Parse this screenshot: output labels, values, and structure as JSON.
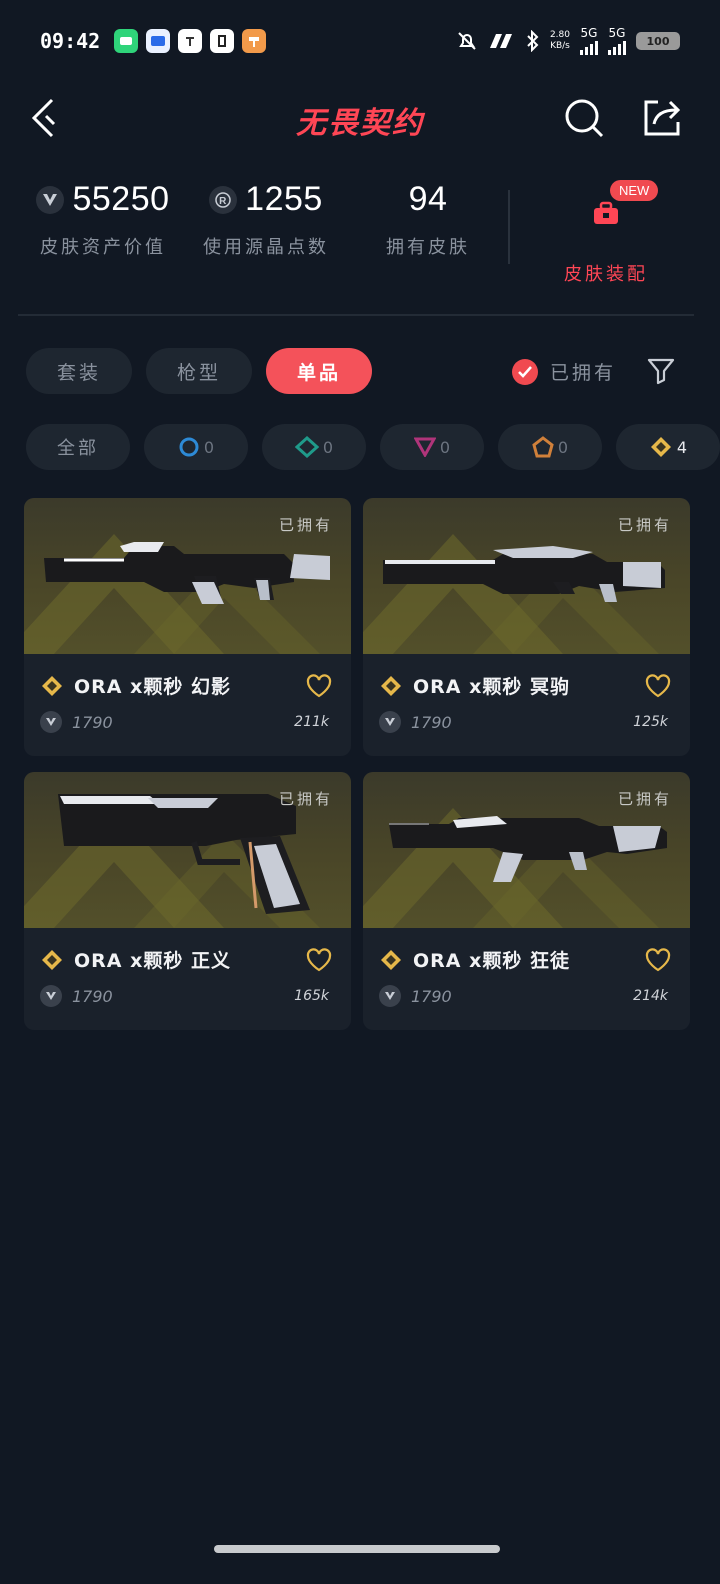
{
  "status_bar": {
    "time": "09:42",
    "net_speed_top": "2.80",
    "net_speed_bottom": "KB/s",
    "signal1": "5G",
    "signal2": "5G",
    "battery": "100"
  },
  "header": {
    "logo_text": "无畏契约"
  },
  "stats": {
    "asset_value": "55250",
    "asset_label": "皮肤资产价值",
    "radianite": "1255",
    "radianite_label": "使用源晶点数",
    "skins_count": "94",
    "skins_label": "拥有皮肤",
    "equip_label": "皮肤装配",
    "new_badge": "NEW"
  },
  "category_tabs": [
    {
      "label": "套装",
      "active": false
    },
    {
      "label": "枪型",
      "active": false
    },
    {
      "label": "单品",
      "active": true
    }
  ],
  "owned_filter": {
    "label": "已拥有",
    "checked": true
  },
  "tier_filters": [
    {
      "label": "全部",
      "count": ""
    },
    {
      "tier": "select",
      "count": "0"
    },
    {
      "tier": "deluxe",
      "count": "0"
    },
    {
      "tier": "premium",
      "count": "0"
    },
    {
      "tier": "ultra",
      "count": "0"
    },
    {
      "tier": "exclusive",
      "count": "4"
    }
  ],
  "colors": {
    "accent": "#ff4655",
    "background": "#111823",
    "card": "#1a212b",
    "tier_exclusive": "#e6b84a"
  },
  "skins": [
    {
      "name": "ORA x颗秒 幻影",
      "owned_tag": "已拥有",
      "price": "1790",
      "likes": "211k",
      "tier_icon": "exclusive-diamond-icon"
    },
    {
      "name": "ORA x颗秒 冥驹",
      "owned_tag": "已拥有",
      "price": "1790",
      "likes": "125k",
      "tier_icon": "exclusive-diamond-icon"
    },
    {
      "name": "ORA x颗秒 正义",
      "owned_tag": "已拥有",
      "price": "1790",
      "likes": "165k",
      "tier_icon": "exclusive-diamond-icon"
    },
    {
      "name": "ORA x颗秒 狂徒",
      "owned_tag": "已拥有",
      "price": "1790",
      "likes": "214k",
      "tier_icon": "exclusive-diamond-icon"
    }
  ]
}
